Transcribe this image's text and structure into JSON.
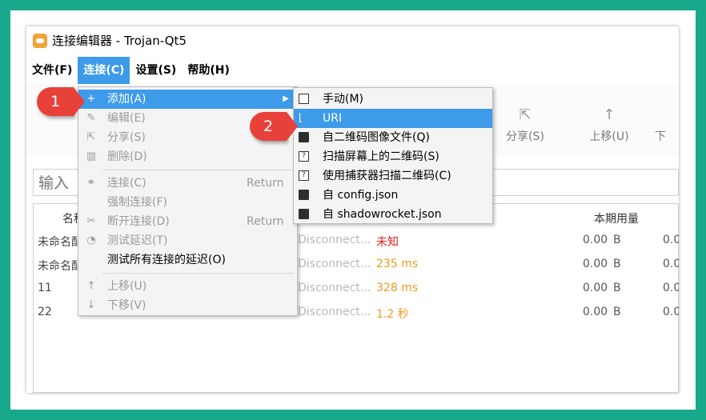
{
  "window": {
    "title": "连接编辑器 - Trojan-Qt5"
  },
  "menubar": [
    "文件(F)",
    "连接(C)",
    "设置(S)",
    "帮助(H)"
  ],
  "toolbar": {
    "share": "分享(S)",
    "move_up": "上移(U)",
    "more": "下"
  },
  "search": {
    "placeholder": "输入"
  },
  "table": {
    "headers": {
      "name": "名称",
      "usage": "本期用量"
    },
    "rows": [
      {
        "name": "未命名配",
        "status": "Disconnect...",
        "latency": "未知",
        "latency_color": "#e02020",
        "usage": "0.00",
        "unit": "B",
        "more": "0.0"
      },
      {
        "name": "未命名配",
        "status": "Disconnect...",
        "latency": "235 ms",
        "latency_color": "#f09a1a",
        "usage": "0.00",
        "unit": "B",
        "more": "0.0"
      },
      {
        "name": "11",
        "status": "Disconnect...",
        "latency": "328 ms",
        "latency_color": "#f09a1a",
        "usage": "0.00",
        "unit": "B",
        "more": "0.0"
      },
      {
        "name": "22",
        "status": "Disconnect...",
        "latency": "1.2 秒",
        "latency_color": "#f09a1a",
        "usage": "0.00",
        "unit": "B",
        "more": "0.0"
      }
    ]
  },
  "connection_menu": {
    "add": "添加(A)",
    "edit": "编辑(E)",
    "share": "分享(S)",
    "delete": "删除(D)",
    "connect": "连接(C)",
    "connect_shortcut": "Return",
    "force_connect": "强制连接(F)",
    "disconnect": "断开连接(D)",
    "disconnect_shortcut": "Return",
    "test_latency": "测试延迟(T)",
    "test_all": "测试所有连接的延迟(O)",
    "move_up": "上移(U)",
    "move_down": "下移(V)"
  },
  "add_submenu": {
    "manual": "手动(M)",
    "uri": "URI",
    "qr_file": "自二维码图像文件(Q)",
    "scan_screen": "扫描屏幕上的二维码(S)",
    "scan_capture": "使用捕获器扫描二维码(C)",
    "config_json": "自 config.json",
    "shadowrocket_json": "自 shadowrocket.json"
  },
  "annotations": {
    "step1": "1",
    "step2": "2"
  },
  "colors": {
    "frame": "#18a98d",
    "highlight": "#3d9bea",
    "badge": "#e8413a"
  }
}
